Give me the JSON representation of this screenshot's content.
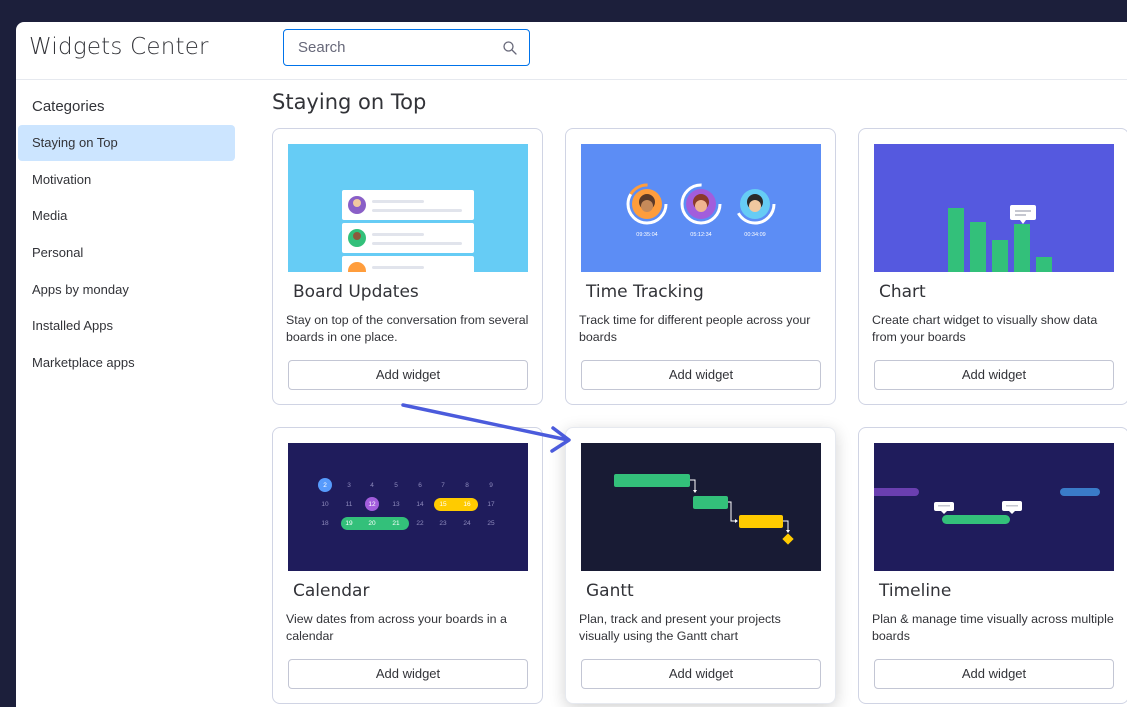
{
  "header": {
    "title": "Widgets Center",
    "search_placeholder": "Search"
  },
  "sidebar": {
    "heading": "Categories",
    "items": [
      {
        "label": "Staying on Top",
        "active": true
      },
      {
        "label": "Motivation"
      },
      {
        "label": "Media"
      },
      {
        "label": "Personal"
      },
      {
        "label": "Apps by monday"
      },
      {
        "label": "Installed Apps"
      },
      {
        "label": "Marketplace apps"
      }
    ]
  },
  "main": {
    "section_title": "Staying on Top",
    "cards": [
      {
        "title": "Board Updates",
        "desc": "Stay on top of the conversation from several boards in one place.",
        "button": "Add widget"
      },
      {
        "title": "Time Tracking",
        "desc": "Track time for different people across your boards",
        "button": "Add widget",
        "timers": [
          "09:35:04",
          "05:12:34",
          "00:34:09"
        ]
      },
      {
        "title": "Chart",
        "desc": "Create chart widget to visually show data from your boards",
        "button": "Add widget"
      },
      {
        "title": "Calendar",
        "desc": "View dates from across your boards in a calendar",
        "button": "Add widget",
        "days_row1": [
          "2",
          "3",
          "4",
          "5",
          "6",
          "7",
          "8",
          "9"
        ],
        "days_row2": [
          "10",
          "11",
          "12",
          "13",
          "14",
          "15",
          "16",
          "17"
        ],
        "days_row3": [
          "18",
          "19",
          "20",
          "21",
          "22",
          "23",
          "24",
          "25"
        ]
      },
      {
        "title": "Gantt",
        "desc": "Plan, track and present your projects visually using the Gantt chart",
        "button": "Add widget"
      },
      {
        "title": "Timeline",
        "desc": "Plan & manage time visually across multiple boards",
        "button": "Add widget"
      }
    ]
  },
  "colors": {
    "accent": "#0073ea",
    "active_bg": "#cce5ff",
    "annotation_arrow": "#4b5bdc",
    "outer_bg": "#1c1f3b"
  }
}
